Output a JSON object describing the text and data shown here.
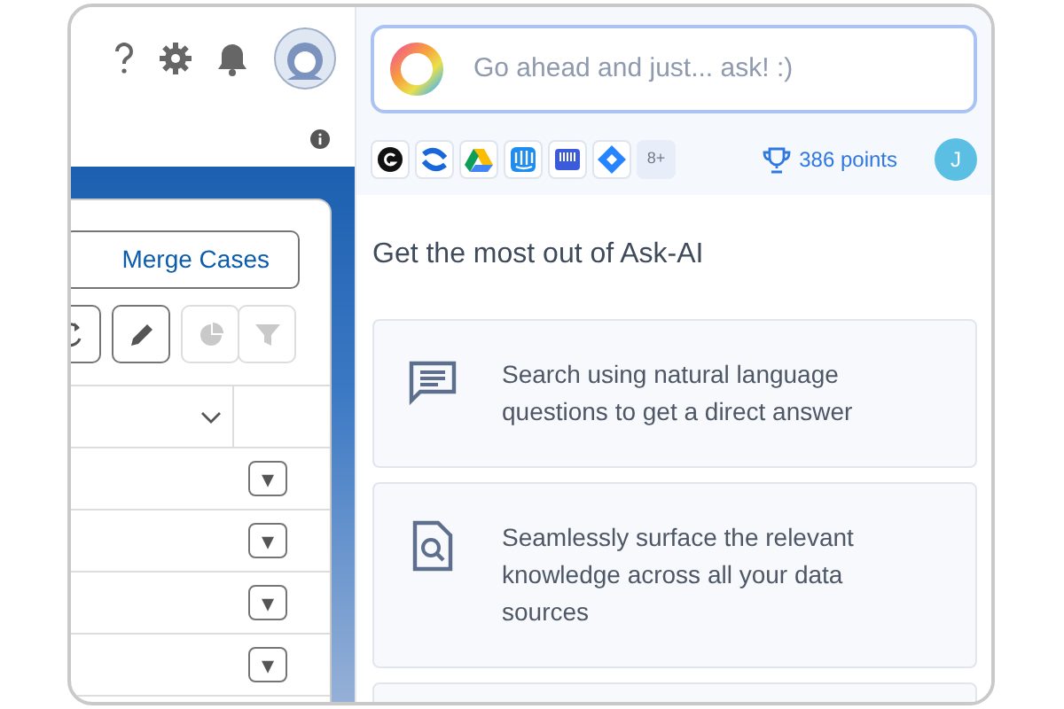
{
  "header": {
    "icons": [
      {
        "kind": "help"
      },
      {
        "kind": "settings"
      },
      {
        "kind": "bell"
      },
      {
        "kind": "avatar"
      }
    ]
  },
  "cases": {
    "merge_button": "Merge Cases",
    "tools": [
      {
        "kind": "refresh",
        "disabled": false
      },
      {
        "kind": "edit",
        "disabled": false
      },
      {
        "kind": "chart",
        "disabled": true
      },
      {
        "kind": "filter",
        "disabled": true
      }
    ],
    "rows": [
      {
        "menu": "▾"
      },
      {
        "menu": "▾"
      },
      {
        "menu": "▾"
      },
      {
        "menu": "▾"
      }
    ]
  },
  "assistant": {
    "search": {
      "placeholder": "Go ahead and just... ask! :)"
    },
    "sources": [
      {
        "kind": "g"
      },
      {
        "kind": "confluence"
      },
      {
        "kind": "drive"
      },
      {
        "kind": "intercom"
      },
      {
        "kind": "server"
      },
      {
        "kind": "jira"
      }
    ],
    "more_sources": "8+",
    "points": "386 points",
    "user_initial": "J",
    "title": "Get the most out of Ask-AI",
    "features": [
      {
        "kind": "chat",
        "text": "Search using natural language questions to get a direct answer"
      },
      {
        "kind": "doc-search",
        "text": "Seamlessly surface the relevant knowledge across all your data sources"
      },
      {
        "kind": "empty"
      }
    ]
  }
}
